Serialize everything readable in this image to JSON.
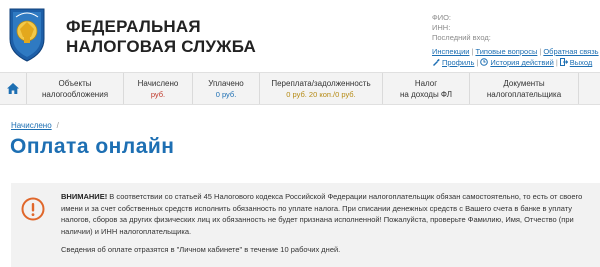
{
  "header": {
    "org_line1": "ФЕДЕРАЛЬНАЯ",
    "org_line2": "НАЛОГОВАЯ СЛУЖБА",
    "user": {
      "fio_label": "ФИО:",
      "inn_label": "ИНН:",
      "last_login_label": "Последний вход:"
    },
    "links": {
      "inspections": "Инспекции",
      "faq": "Типовые вопросы",
      "feedback": "Обратная связь",
      "profile": "Профиль",
      "history": "История действий",
      "logout": "Выход"
    }
  },
  "nav": {
    "items": [
      {
        "line1": "Объекты",
        "line2": "налогообложения"
      },
      {
        "line1": "Начислено",
        "line2": "руб."
      },
      {
        "line1": "Уплачено",
        "line2": "0 руб."
      },
      {
        "line1": "Переплата/задолженность",
        "line2": "0 руб. 20 коп./0 руб."
      },
      {
        "line1": "Налог",
        "line2": "на доходы ФЛ"
      },
      {
        "line1": "Документы",
        "line2": "налогоплательщика"
      }
    ]
  },
  "breadcrumb": {
    "item": "Начислено",
    "separator": "/"
  },
  "page_title": "Оплата онлайн",
  "notice": {
    "heading": "ВНИМАНИЕ!",
    "paragraph1": " В соответствии со статьей 45 Налогового кодекса Российской Федерации налогоплательщик обязан самостоятельно, то есть от своего имени и за счет собственных средств исполнить обязанность по уплате налога. При списании денежных средств с Вашего счета в банке в уплату налогов, сборов за других физических лиц их обязанность не будет признана исполненной! Пожалуйста, проверьте Фамилию, Имя, Отчество (при наличии) и ИНН налогоплательщика.",
    "paragraph2": "Сведения об оплате отразятся в \"Личном кабинете\" в течение 10 рабочих дней."
  },
  "colors": {
    "accent_blue": "#1d6fb3",
    "red": "#c0392b",
    "notice_bg": "#f2f2f2",
    "warning_orange": "#e0672b"
  }
}
